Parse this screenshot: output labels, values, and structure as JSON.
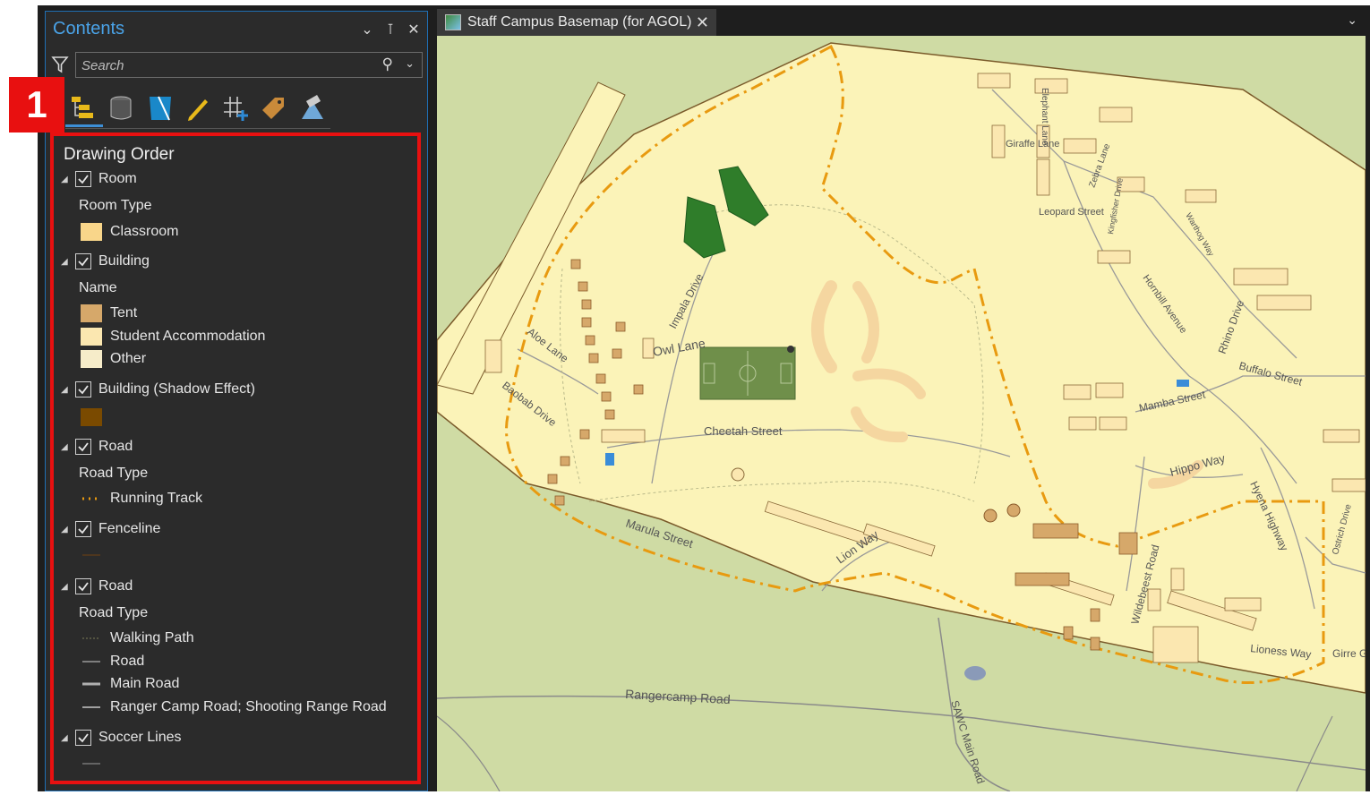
{
  "callout": {
    "number": "1"
  },
  "contents_pane": {
    "title": "Contents",
    "search_placeholder": "Search",
    "heading": "Drawing Order",
    "layers": [
      {
        "name": "Room",
        "group_label": "Room Type",
        "items": [
          "Classroom"
        ]
      },
      {
        "name": "Building",
        "group_label": "Name",
        "items": [
          "Tent",
          "Student Accommodation",
          "Other"
        ]
      },
      {
        "name": "Building (Shadow Effect)"
      },
      {
        "name": "Road",
        "group_label": "Road Type",
        "items": [
          "Running Track"
        ]
      },
      {
        "name": "Fenceline"
      },
      {
        "name": "Road",
        "group_label": "Road Type",
        "items": [
          "Walking Path",
          "Road",
          "Main Road",
          "Ranger Camp Road; Shooting Range Road"
        ]
      },
      {
        "name": "Soccer Lines"
      }
    ],
    "colors": {
      "classroom": "#f9d68a",
      "tent": "#d6a86a",
      "student_accommodation": "#fbe7b0",
      "other": "#f6ecc9",
      "shadow": "#7a4a00",
      "running_track": "#e89a10"
    }
  },
  "map_view": {
    "tab_title": "Staff Campus Basemap (for AGOL)",
    "labels": {
      "giraffe_lane": "Giraffe Lane",
      "elephant_lane": "Elephant Lane",
      "zebra_lane": "Zebra Lane",
      "leopard_street": "Leopard Street",
      "kingfisher_drive": "Kingfisher Drive",
      "warthog_way": "Warthog Way",
      "hornbill_avenue": "Hornbill Avenue",
      "rhino_drive": "Rhino Drive",
      "buffalo_street": "Buffalo Street",
      "mamba_street": "Mamba Street",
      "impala_drive": "Impala Drive",
      "owl_lane": "Owl Lane",
      "aloe_lane": "Aloe Lane",
      "baobab_drive": "Baobab Drive",
      "cheetah_street": "Cheetah Street",
      "marula_street": "Marula Street",
      "lion_way": "Lion Way",
      "hippo_way": "Hippo Way",
      "hyena_highway": "Hyena Highway",
      "ostrich_drive": "Ostrich Drive",
      "wildebeest_road": "Wildebeest Road",
      "lioness_way": "Lioness Way",
      "giraffe_gro": "Girre Gro",
      "rangercamp_road": "Rangercamp Road",
      "sawc_main_road": "SAWC Main Road"
    },
    "colors": {
      "background": "#cfdba4",
      "campus": "#fbf3b8",
      "running_track": "#e89a10",
      "soccer_field": "#6f8f4a"
    }
  }
}
